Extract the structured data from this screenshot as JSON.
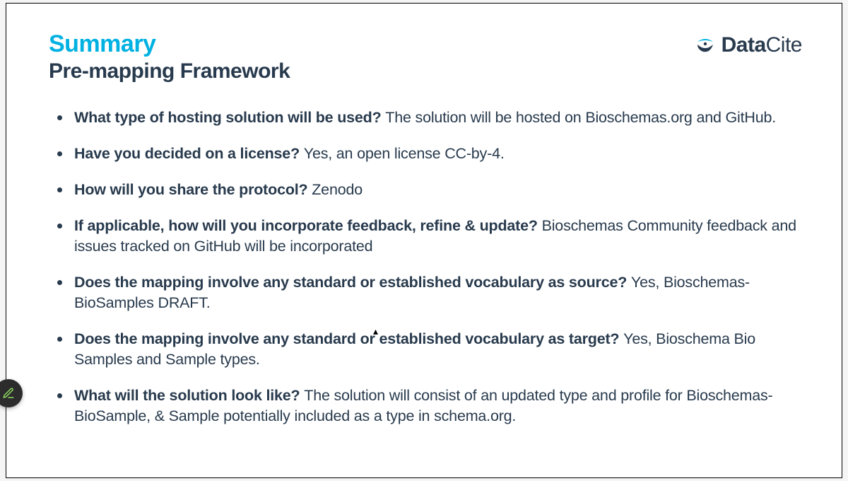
{
  "header": {
    "title": "Summary",
    "subtitle": "Pre-mapping Framework"
  },
  "logo": {
    "bold": "Data",
    "light": "Cite"
  },
  "bullets": [
    {
      "q": "What type of hosting solution will be used? ",
      "a": "The solution will be hosted on Bioschemas.org and GitHub."
    },
    {
      "q": "Have you decided on a license? ",
      "a": "Yes, an open license  CC-by-4."
    },
    {
      "q": "How will you share the protocol? ",
      "a": "Zenodo"
    },
    {
      "q": "If applicable, how will you incorporate feedback, refine & update? ",
      "a": "Bioschemas Community feedback and issues tracked on GitHub will be incorporated"
    },
    {
      "q": "Does the mapping involve any standard or established vocabulary as source? ",
      "a": "Yes, Bioschemas-BioSamples DRAFT."
    },
    {
      "q": "Does the mapping involve any standard or established vocabulary as target? ",
      "a": "Yes, Bioschema Bio Samples and Sample types."
    },
    {
      "q": "What will the solution look like? ",
      "a": "The solution will consist of an updated type and profile for Bioschemas-BioSample, & Sample  potentially included as a type in schema.org."
    }
  ]
}
